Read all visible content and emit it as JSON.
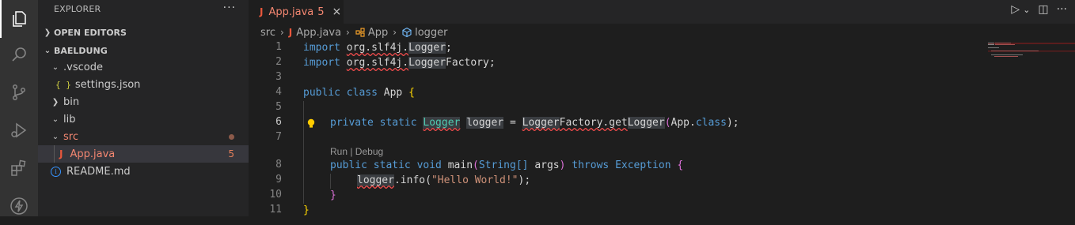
{
  "activity_bar": {
    "items": [
      "explorer-icon",
      "search-icon",
      "source-control-icon",
      "run-debug-icon",
      "extensions-icon",
      "thunder-icon"
    ]
  },
  "sidebar": {
    "title": "EXPLORER",
    "more": "···",
    "open_editors_label": "OPEN EDITORS",
    "workspace_label": "BAELDUNG",
    "tree": [
      {
        "label": ".vscode",
        "kind": "folder",
        "expanded": true
      },
      {
        "label": "settings.json",
        "kind": "json"
      },
      {
        "label": "bin",
        "kind": "folder",
        "expanded": false
      },
      {
        "label": "lib",
        "kind": "folder",
        "expanded": true
      },
      {
        "label": "src",
        "kind": "folder",
        "expanded": true
      },
      {
        "label": "App.java",
        "kind": "java",
        "errors": "5"
      },
      {
        "label": "README.md",
        "kind": "info"
      }
    ]
  },
  "editor": {
    "tab": {
      "label": "App.java",
      "count": "5",
      "close": "×"
    },
    "actions": {
      "run": "▷",
      "run_dropdown": "⌄",
      "split": "◫",
      "more": "···"
    },
    "breadcrumb": [
      "src",
      "App.java",
      "App",
      "logger"
    ],
    "breadcrumb_sep": "›",
    "line_numbers": [
      "1",
      "2",
      "3",
      "4",
      "5",
      "6",
      "7",
      "8",
      "9",
      "10",
      "11"
    ],
    "codelens": "Run | Debug",
    "code": {
      "l1_kw": "import",
      "l1_pkg": "org.slf4j.",
      "l1_cls": "Logger",
      "l1_end": ";",
      "l2_kw": "import",
      "l2_pkg": "org.slf4j.",
      "l2_cls": "Logger",
      "l2_rest": "Factory",
      "l2_end": ";",
      "l4_mods": "public class",
      "l4_name": "App",
      "l4_brace": "{",
      "l6_mods": "private static",
      "l6_type": "Logger",
      "l6_var": "logger",
      "l6_eq": " = ",
      "l6_a": "Logger",
      "l6_b": "Factory.get",
      "l6_c": "Logger",
      "l6_p1": "(",
      "l6_arg": "App.",
      "l6_cls": "class",
      "l6_p2": ");",
      "l8_mods": "public static void",
      "l8_fn": "main",
      "l8_p1": "(",
      "l8_type": "String[]",
      "l8_arg": "args",
      "l8_p2": ")",
      "l8_throws": "throws",
      "l8_exc": "Exception",
      "l8_brace": "{",
      "l9_var": "logger",
      "l9_call": ".info(",
      "l9_str": "\"Hello World!\"",
      "l9_end": ");",
      "l10": "}",
      "l11": "}"
    }
  }
}
